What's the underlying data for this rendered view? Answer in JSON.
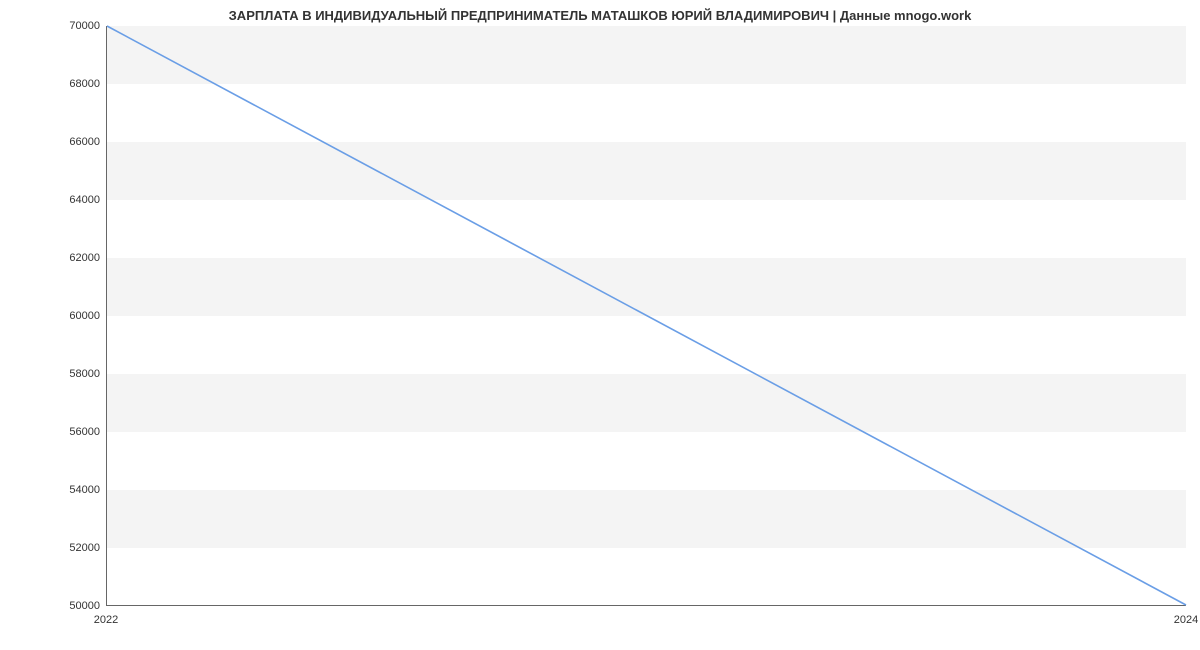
{
  "chart_data": {
    "type": "line",
    "title": "ЗАРПЛАТА В ИНДИВИДУАЛЬНЫЙ ПРЕДПРИНИМАТЕЛЬ МАТАШКОВ ЮРИЙ ВЛАДИМИРОВИЧ | Данные mnogo.work",
    "x": [
      2022,
      2024
    ],
    "values": [
      70000,
      50000
    ],
    "xlabel": "",
    "ylabel": "",
    "xlim": [
      2022,
      2024
    ],
    "ylim": [
      50000,
      70000
    ],
    "x_ticks": [
      2022,
      2024
    ],
    "y_ticks": [
      50000,
      52000,
      54000,
      56000,
      58000,
      60000,
      62000,
      64000,
      66000,
      68000,
      70000
    ],
    "line_color": "#6a9ee6"
  }
}
